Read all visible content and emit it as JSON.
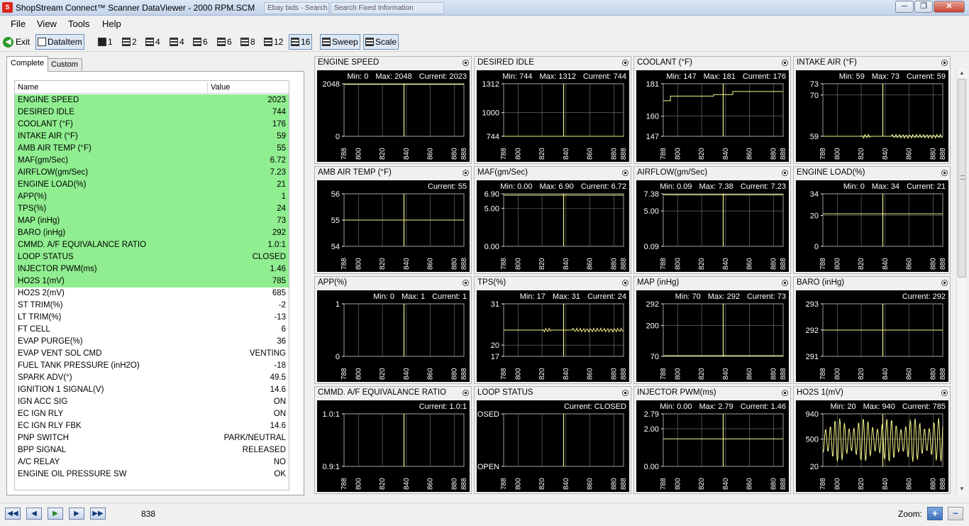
{
  "window": {
    "title": "ShopStream Connect™ Scanner DataViewer - 2000 RPM.SCM",
    "icon": "shopstream-logo-icon",
    "background_tabs": [
      "Ebay bids - Search",
      "Search Fixed Information"
    ],
    "controls": {
      "minimize": "─",
      "maximize": "❐",
      "close": "✕"
    }
  },
  "menu": [
    "File",
    "View",
    "Tools",
    "Help"
  ],
  "toolbar": {
    "exit_label": "Exit",
    "dataitem_label": "DataItem",
    "layouts": [
      "1",
      "2",
      "4",
      "4",
      "6",
      "6",
      "8",
      "12",
      "16"
    ],
    "sweep_label": "Sweep",
    "scale_label": "Scale"
  },
  "tabs": [
    "Complete",
    "Custom"
  ],
  "list": {
    "col_name": "Name",
    "col_value": "Value",
    "rows": [
      {
        "name": "ENGINE SPEED",
        "value": "2023",
        "hl": true
      },
      {
        "name": "DESIRED IDLE",
        "value": "744",
        "hl": true
      },
      {
        "name": "COOLANT (°F)",
        "value": "176",
        "hl": true
      },
      {
        "name": "INTAKE AIR (°F)",
        "value": "59",
        "hl": true
      },
      {
        "name": "AMB AIR TEMP (°F)",
        "value": "55",
        "hl": true
      },
      {
        "name": "MAF(gm/Sec)",
        "value": "6.72",
        "hl": true
      },
      {
        "name": "AIRFLOW(gm/Sec)",
        "value": "7.23",
        "hl": true
      },
      {
        "name": "ENGINE LOAD(%)",
        "value": "21",
        "hl": true
      },
      {
        "name": "APP(%)",
        "value": "1",
        "hl": true
      },
      {
        "name": "TPS(%)",
        "value": "24",
        "hl": true
      },
      {
        "name": "MAP (inHg)",
        "value": "73",
        "hl": true
      },
      {
        "name": "BARO (inHg)",
        "value": "292",
        "hl": true
      },
      {
        "name": "CMMD. A/F EQUIVALANCE RATIO",
        "value": "1.0:1",
        "hl": true
      },
      {
        "name": "LOOP STATUS",
        "value": "CLOSED",
        "hl": true
      },
      {
        "name": "INJECTOR PWM(ms)",
        "value": "1.46",
        "hl": true
      },
      {
        "name": "HO2S 1(mV)",
        "value": "785",
        "hl": true
      },
      {
        "name": "HO2S 2(mV)",
        "value": "685",
        "hl": false
      },
      {
        "name": "ST TRIM(%)",
        "value": "-2",
        "hl": false
      },
      {
        "name": "LT TRIM(%)",
        "value": "-13",
        "hl": false
      },
      {
        "name": "FT CELL",
        "value": "6",
        "hl": false
      },
      {
        "name": "EVAP PURGE(%)",
        "value": "36",
        "hl": false
      },
      {
        "name": "EVAP VENT SOL CMD",
        "value": "VENTING",
        "hl": false
      },
      {
        "name": "FUEL TANK PRESSURE  (inH2O)",
        "value": "-18",
        "hl": false
      },
      {
        "name": "SPARK ADV(°)",
        "value": "49.5",
        "hl": false
      },
      {
        "name": "IGNITION 1 SIGNAL(V)",
        "value": "14.6",
        "hl": false
      },
      {
        "name": "IGN ACC SIG",
        "value": "ON",
        "hl": false
      },
      {
        "name": "EC IGN RLY",
        "value": "ON",
        "hl": false
      },
      {
        "name": "EC IGN RLY FBK",
        "value": "14.6",
        "hl": false
      },
      {
        "name": "PNP SWITCH",
        "value": "PARK/NEUTRAL",
        "hl": false
      },
      {
        "name": "BPP SIGNAL",
        "value": "RELEASED",
        "hl": false
      },
      {
        "name": "A/C RELAY",
        "value": "NO",
        "hl": false
      },
      {
        "name": "ENGINE OIL PRESSURE SW",
        "value": "OK",
        "hl": false
      }
    ]
  },
  "graphs": {
    "x_ticks": [
      "788",
      "800",
      "820",
      "840",
      "860",
      "880",
      "888"
    ],
    "x_range": [
      788,
      888
    ],
    "cursor_frame": 838,
    "items": [
      {
        "title": "ENGINE SPEED",
        "min_label": "Min: 0",
        "max_label": "Max: 2048",
        "current_label": "Current: 2023",
        "ylim": [
          0,
          2048
        ],
        "yticks": [
          "2048",
          "0"
        ],
        "ytick_vals": [
          2048,
          0
        ],
        "trace": [
          {
            "x": 788,
            "y": 2023
          },
          {
            "x": 888,
            "y": 2023
          }
        ],
        "kind": "flat"
      },
      {
        "title": "DESIRED IDLE",
        "min_label": "Min: 744",
        "max_label": "Max: 1312",
        "current_label": "Current: 744",
        "ylim": [
          744,
          1312
        ],
        "yticks": [
          "1312",
          "1000",
          "744"
        ],
        "ytick_vals": [
          1312,
          1000,
          744
        ],
        "trace": [
          {
            "x": 788,
            "y": 744
          },
          {
            "x": 888,
            "y": 744
          }
        ],
        "kind": "flat"
      },
      {
        "title": "COOLANT (°F)",
        "min_label": "Min: 147",
        "max_label": "Max: 181",
        "current_label": "Current: 176",
        "ylim": [
          147,
          181
        ],
        "yticks": [
          "181",
          "160",
          "147"
        ],
        "ytick_vals": [
          181,
          160,
          147
        ],
        "trace": [
          {
            "x": 788,
            "y": 170
          },
          {
            "x": 794,
            "y": 173
          },
          {
            "x": 830,
            "y": 174
          },
          {
            "x": 846,
            "y": 176
          },
          {
            "x": 888,
            "y": 176
          }
        ],
        "kind": "step"
      },
      {
        "title": "INTAKE AIR (°F)",
        "min_label": "Min: 59",
        "max_label": "Max: 73",
        "current_label": "Current: 59",
        "ylim": [
          59,
          73
        ],
        "yticks": [
          "73",
          "70",
          "59"
        ],
        "ytick_vals": [
          73,
          70,
          59
        ],
        "trace": [
          {
            "x": 788,
            "y": 59
          },
          {
            "x": 888,
            "y": 59
          }
        ],
        "kind": "noisy"
      },
      {
        "title": "AMB AIR TEMP (°F)",
        "min_label": "",
        "max_label": "",
        "current_label": "Current: 55",
        "ylim": [
          54,
          56
        ],
        "yticks": [
          "56",
          "55",
          "54"
        ],
        "ytick_vals": [
          56,
          55,
          54
        ],
        "trace": [
          {
            "x": 788,
            "y": 55
          },
          {
            "x": 888,
            "y": 55
          }
        ],
        "kind": "flat"
      },
      {
        "title": "MAF(gm/Sec)",
        "min_label": "Min: 0.00",
        "max_label": "Max: 6.90",
        "current_label": "Current: 6.72",
        "ylim": [
          0,
          6.9
        ],
        "yticks": [
          "6.90",
          "5.00",
          "0.00"
        ],
        "ytick_vals": [
          6.9,
          5,
          0
        ],
        "trace": [
          {
            "x": 788,
            "y": 6.72
          },
          {
            "x": 888,
            "y": 6.72
          }
        ],
        "kind": "flat"
      },
      {
        "title": "AIRFLOW(gm/Sec)",
        "min_label": "Min: 0.09",
        "max_label": "Max: 7.38",
        "current_label": "Current: 7.23",
        "ylim": [
          0.09,
          7.38
        ],
        "yticks": [
          "7.38",
          "5.00",
          "0.09"
        ],
        "ytick_vals": [
          7.38,
          5,
          0.09
        ],
        "trace": [
          {
            "x": 788,
            "y": 7.23
          },
          {
            "x": 888,
            "y": 7.23
          }
        ],
        "kind": "flat"
      },
      {
        "title": "ENGINE LOAD(%)",
        "min_label": "Min: 0",
        "max_label": "Max: 34",
        "current_label": "Current: 21",
        "ylim": [
          0,
          34
        ],
        "yticks": [
          "34",
          "20",
          "0"
        ],
        "ytick_vals": [
          34,
          20,
          0
        ],
        "trace": [
          {
            "x": 788,
            "y": 21
          },
          {
            "x": 888,
            "y": 21
          }
        ],
        "kind": "flat"
      },
      {
        "title": "APP(%)",
        "min_label": "Min: 0",
        "max_label": "Max: 1",
        "current_label": "Current: 1",
        "ylim": [
          0,
          1
        ],
        "yticks": [
          "1",
          "0"
        ],
        "ytick_vals": [
          1,
          0
        ],
        "trace": [],
        "kind": "flat"
      },
      {
        "title": "TPS(%)",
        "min_label": "Min: 17",
        "max_label": "Max: 31",
        "current_label": "Current: 24",
        "ylim": [
          17,
          31
        ],
        "yticks": [
          "31",
          "20",
          "17"
        ],
        "ytick_vals": [
          31,
          20,
          17
        ],
        "trace": [
          {
            "x": 788,
            "y": 24
          },
          {
            "x": 888,
            "y": 24
          }
        ],
        "kind": "noisy"
      },
      {
        "title": "MAP (inHg)",
        "min_label": "Min: 70",
        "max_label": "Max: 292",
        "current_label": "Current: 73",
        "ylim": [
          70,
          292
        ],
        "yticks": [
          "292",
          "200",
          "70"
        ],
        "ytick_vals": [
          292,
          200,
          70
        ],
        "trace": [
          {
            "x": 788,
            "y": 73
          },
          {
            "x": 888,
            "y": 73
          }
        ],
        "kind": "flat"
      },
      {
        "title": "BARO (inHg)",
        "min_label": "",
        "max_label": "",
        "current_label": "Current: 292",
        "ylim": [
          291,
          293
        ],
        "yticks": [
          "293",
          "292",
          "291"
        ],
        "ytick_vals": [
          293,
          292,
          291
        ],
        "trace": [
          {
            "x": 788,
            "y": 292
          },
          {
            "x": 888,
            "y": 292
          }
        ],
        "kind": "flat"
      },
      {
        "title": "CMMD. A/F EQUIVALANCE RATIO",
        "min_label": "",
        "max_label": "",
        "current_label": "Current: 1.0:1",
        "ylim": [
          0.9,
          1.0
        ],
        "yticks": [
          "1.0:1",
          "0.9:1"
        ],
        "ytick_vals": [
          1.0,
          0.9
        ],
        "trace": [],
        "kind": "flat"
      },
      {
        "title": "LOOP STATUS",
        "min_label": "",
        "max_label": "",
        "current_label": "Current: CLOSED",
        "ylim": [
          0,
          1
        ],
        "yticks": [
          "CLOSED",
          "OPEN"
        ],
        "ytick_vals": [
          1,
          0
        ],
        "trace": [],
        "kind": "flat"
      },
      {
        "title": "INJECTOR PWM(ms)",
        "min_label": "Min: 0.00",
        "max_label": "Max: 2.79",
        "current_label": "Current: 1.46",
        "ylim": [
          0,
          2.79
        ],
        "yticks": [
          "2.79",
          "2.00",
          "0.00"
        ],
        "ytick_vals": [
          2.79,
          2,
          0
        ],
        "trace": [
          {
            "x": 788,
            "y": 1.46
          },
          {
            "x": 888,
            "y": 1.46
          }
        ],
        "kind": "flat"
      },
      {
        "title": "HO2S 1(mV)",
        "min_label": "Min: 20",
        "max_label": "Max: 940",
        "current_label": "Current: 785",
        "ylim": [
          20,
          940
        ],
        "yticks": [
          "940",
          "500",
          "20"
        ],
        "ytick_vals": [
          940,
          500,
          20
        ],
        "trace": [
          {
            "x": 788,
            "y": 500
          },
          {
            "x": 888,
            "y": 785
          }
        ],
        "kind": "osc"
      }
    ]
  },
  "statusbar": {
    "frame": "838",
    "zoom_label": "Zoom:",
    "nav": [
      "first-frame-icon",
      "prev-frame-icon",
      "play-icon",
      "next-frame-icon",
      "last-frame-icon"
    ]
  },
  "colors": {
    "trace": "#f5f58a",
    "plot_bg": "#000000",
    "highlight": "#90ee90",
    "grid": "#7a7a7a"
  }
}
